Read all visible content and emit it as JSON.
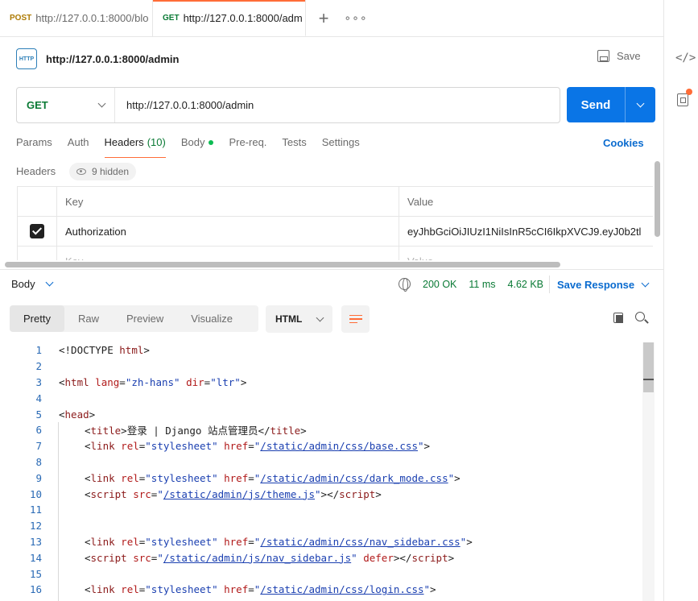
{
  "tabs": [
    {
      "method": "POST",
      "title": "http://127.0.0.1:8000/blo"
    },
    {
      "method": "GET",
      "title": "http://127.0.0.1:8000/adm"
    }
  ],
  "tab_add": "+",
  "tab_more": "∘∘∘",
  "request": {
    "icon": "HTTP",
    "name": "http://127.0.0.1:8000/admin",
    "save_label": "Save",
    "method": "GET",
    "url": "http://127.0.0.1:8000/admin",
    "send_label": "Send"
  },
  "request_tabs": {
    "params": "Params",
    "auth": "Auth",
    "headers": "Headers",
    "headers_count": "(10)",
    "body": "Body",
    "prereq": "Pre-req.",
    "tests": "Tests",
    "settings": "Settings",
    "cookies": "Cookies"
  },
  "headers": {
    "label": "Headers",
    "hidden": "9 hidden",
    "col_key": "Key",
    "col_value": "Value",
    "rows": [
      {
        "checked": true,
        "key": "Authorization",
        "value": "eyJhbGciOiJIUzI1NiIsInR5cCI6IkpXVCJ9.eyJ0b2tl"
      }
    ],
    "placeholder_key": "Key",
    "placeholder_value": "Value"
  },
  "response": {
    "body_label": "Body",
    "status": "200 OK",
    "time": "11 ms",
    "size": "4.62 KB",
    "save_response": "Save Response",
    "view_tabs": [
      "Pretty",
      "Raw",
      "Preview",
      "Visualize"
    ],
    "active_view": "Pretty",
    "language": "HTML"
  },
  "code_lines": [
    {
      "n": "1",
      "indent": 0,
      "parts": [
        [
          "tag",
          "<!DOCTYPE "
        ],
        [
          "name",
          "html"
        ],
        [
          "tag",
          ">"
        ]
      ]
    },
    {
      "n": "2",
      "indent": 0,
      "parts": []
    },
    {
      "n": "3",
      "indent": 0,
      "parts": [
        [
          "tag",
          "<"
        ],
        [
          "name",
          "html"
        ],
        [
          "tag",
          " "
        ],
        [
          "attr",
          "lang"
        ],
        [
          "tag",
          "="
        ],
        [
          "str",
          "\"zh-hans\""
        ],
        [
          "tag",
          " "
        ],
        [
          "attr",
          "dir"
        ],
        [
          "tag",
          "="
        ],
        [
          "str",
          "\"ltr\""
        ],
        [
          "tag",
          ">"
        ]
      ]
    },
    {
      "n": "4",
      "indent": 0,
      "parts": []
    },
    {
      "n": "5",
      "indent": 0,
      "parts": [
        [
          "tag",
          "<"
        ],
        [
          "name",
          "head"
        ],
        [
          "tag",
          ">"
        ]
      ]
    },
    {
      "n": "6",
      "indent": 1,
      "parts": [
        [
          "tag",
          "<"
        ],
        [
          "name",
          "title"
        ],
        [
          "tag",
          ">"
        ],
        [
          "text",
          "登录 | Django 站点管理员"
        ],
        [
          "tag",
          "</"
        ],
        [
          "name",
          "title"
        ],
        [
          "tag",
          ">"
        ]
      ]
    },
    {
      "n": "7",
      "indent": 1,
      "parts": [
        [
          "tag",
          "<"
        ],
        [
          "name",
          "link"
        ],
        [
          "tag",
          " "
        ],
        [
          "attr",
          "rel"
        ],
        [
          "tag",
          "="
        ],
        [
          "str",
          "\"stylesheet\""
        ],
        [
          "tag",
          " "
        ],
        [
          "attr",
          "href"
        ],
        [
          "tag",
          "="
        ],
        [
          "str",
          "\""
        ],
        [
          "link",
          "/static/admin/css/base.css"
        ],
        [
          "str",
          "\""
        ],
        [
          "tag",
          ">"
        ]
      ]
    },
    {
      "n": "8",
      "indent": 1,
      "parts": []
    },
    {
      "n": "9",
      "indent": 1,
      "parts": [
        [
          "tag",
          "<"
        ],
        [
          "name",
          "link"
        ],
        [
          "tag",
          " "
        ],
        [
          "attr",
          "rel"
        ],
        [
          "tag",
          "="
        ],
        [
          "str",
          "\"stylesheet\""
        ],
        [
          "tag",
          " "
        ],
        [
          "attr",
          "href"
        ],
        [
          "tag",
          "="
        ],
        [
          "str",
          "\""
        ],
        [
          "link",
          "/static/admin/css/dark_mode.css"
        ],
        [
          "str",
          "\""
        ],
        [
          "tag",
          ">"
        ]
      ]
    },
    {
      "n": "10",
      "indent": 1,
      "parts": [
        [
          "tag",
          "<"
        ],
        [
          "name",
          "script"
        ],
        [
          "tag",
          " "
        ],
        [
          "attr",
          "src"
        ],
        [
          "tag",
          "="
        ],
        [
          "str",
          "\""
        ],
        [
          "link",
          "/static/admin/js/theme.js"
        ],
        [
          "str",
          "\""
        ],
        [
          "tag",
          ">"
        ],
        [
          "tag",
          "</"
        ],
        [
          "name",
          "script"
        ],
        [
          "tag",
          ">"
        ]
      ]
    },
    {
      "n": "11",
      "indent": 1,
      "parts": []
    },
    {
      "n": "12",
      "indent": 1,
      "parts": []
    },
    {
      "n": "13",
      "indent": 1,
      "parts": [
        [
          "tag",
          "<"
        ],
        [
          "name",
          "link"
        ],
        [
          "tag",
          " "
        ],
        [
          "attr",
          "rel"
        ],
        [
          "tag",
          "="
        ],
        [
          "str",
          "\"stylesheet\""
        ],
        [
          "tag",
          " "
        ],
        [
          "attr",
          "href"
        ],
        [
          "tag",
          "="
        ],
        [
          "str",
          "\""
        ],
        [
          "link",
          "/static/admin/css/nav_sidebar.css"
        ],
        [
          "str",
          "\""
        ],
        [
          "tag",
          ">"
        ]
      ]
    },
    {
      "n": "14",
      "indent": 1,
      "parts": [
        [
          "tag",
          "<"
        ],
        [
          "name",
          "script"
        ],
        [
          "tag",
          " "
        ],
        [
          "attr",
          "src"
        ],
        [
          "tag",
          "="
        ],
        [
          "str",
          "\""
        ],
        [
          "link",
          "/static/admin/js/nav_sidebar.js"
        ],
        [
          "str",
          "\""
        ],
        [
          "tag",
          " "
        ],
        [
          "attr",
          "defer"
        ],
        [
          "tag",
          ">"
        ],
        [
          "tag",
          "</"
        ],
        [
          "name",
          "script"
        ],
        [
          "tag",
          ">"
        ]
      ]
    },
    {
      "n": "15",
      "indent": 1,
      "parts": []
    },
    {
      "n": "16",
      "indent": 1,
      "parts": [
        [
          "tag",
          "<"
        ],
        [
          "name",
          "link"
        ],
        [
          "tag",
          " "
        ],
        [
          "attr",
          "rel"
        ],
        [
          "tag",
          "="
        ],
        [
          "str",
          "\"stylesheet\""
        ],
        [
          "tag",
          " "
        ],
        [
          "attr",
          "href"
        ],
        [
          "tag",
          "="
        ],
        [
          "str",
          "\""
        ],
        [
          "link",
          "/static/admin/css/login.css"
        ],
        [
          "str",
          "\""
        ],
        [
          "tag",
          ">"
        ]
      ]
    }
  ],
  "colors": {
    "accent": "#ff6c37",
    "send": "#0a75e6",
    "get": "#0a7a35",
    "post": "#ad7a03",
    "link": "#0a6bcf"
  }
}
